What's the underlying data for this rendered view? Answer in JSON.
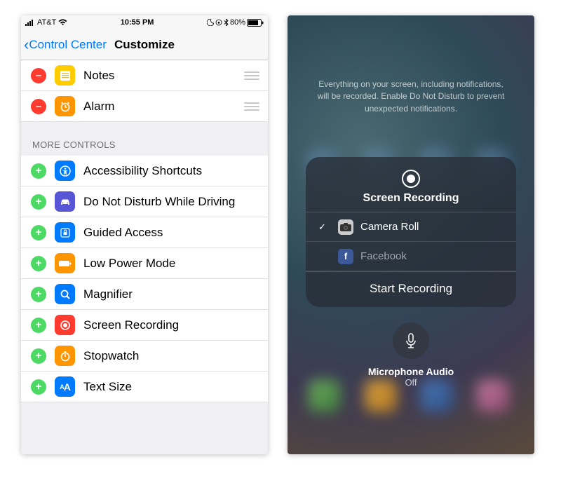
{
  "left": {
    "status": {
      "carrier": "AT&T",
      "time": "10:55 PM",
      "battery": "80%"
    },
    "nav": {
      "back_label": "Control Center",
      "title": "Customize"
    },
    "included": [
      {
        "label": "Notes",
        "icon": "notes",
        "color": "ic-yellow"
      },
      {
        "label": "Alarm",
        "icon": "alarm",
        "color": "ic-orange"
      }
    ],
    "more_header": "MORE CONTROLS",
    "more": [
      {
        "label": "Accessibility Shortcuts",
        "icon": "accessibility",
        "color": "ic-blue"
      },
      {
        "label": "Do Not Disturb While Driving",
        "icon": "car",
        "color": "ic-purple"
      },
      {
        "label": "Guided Access",
        "icon": "lock",
        "color": "ic-blue"
      },
      {
        "label": "Low Power Mode",
        "icon": "battery",
        "color": "ic-orange"
      },
      {
        "label": "Magnifier",
        "icon": "magnifier",
        "color": "ic-blue"
      },
      {
        "label": "Screen Recording",
        "icon": "record",
        "color": "ic-red"
      },
      {
        "label": "Stopwatch",
        "icon": "stopwatch",
        "color": "ic-orange"
      },
      {
        "label": "Text Size",
        "icon": "textsize",
        "color": "ic-blue"
      }
    ]
  },
  "right": {
    "hint": "Everything on your screen, including notifications, will be recorded. Enable Do Not Disturb to prevent unexpected notifications.",
    "panel_title": "Screen Recording",
    "dest": [
      {
        "label": "Camera Roll",
        "selected": true,
        "icon": "camera"
      },
      {
        "label": "Facebook",
        "selected": false,
        "icon": "facebook"
      }
    ],
    "action": "Start Recording",
    "mic_label": "Microphone Audio",
    "mic_state": "Off"
  }
}
